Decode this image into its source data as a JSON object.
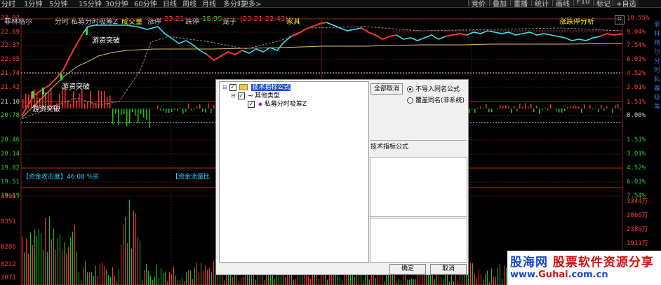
{
  "toolbar": {
    "tabs": [
      "分时",
      "1分钟",
      "5分钟",
      "15分钟",
      "30分钟",
      "60分钟",
      "日线",
      "周线",
      "月线",
      "多分时",
      "更多>"
    ],
    "right_buttons": [
      "竞价",
      "叠加",
      "重播",
      "统计",
      "画线",
      "F10",
      "标记",
      "+自选"
    ]
  },
  "title_bar": {
    "stock_name": "菲林格尔",
    "mode": "分时",
    "indicator_name": "私募分时吸筹Z",
    "volume_label": "成交量",
    "limit_up_label": "涨停",
    "limit_up_value": "23.21",
    "limit_down_label": "跌停",
    "limit_down_value": "18.99",
    "range_label": "笼子",
    "range_value": "(23.21 22.43)",
    "sector": "家具",
    "analysis_button": "涨跌停分析",
    "colors": {
      "up": "#ff4040",
      "down": "#30d030",
      "yellow": "#ffff00"
    }
  },
  "chart": {
    "left_ticks": [
      "23.03",
      "22.69",
      "22.37",
      "22.05",
      "21.74",
      "21.42",
      "21.10",
      "20.78",
      "20.46",
      "20.14",
      "19.82",
      "19.51",
      "19.19"
    ],
    "left_tick_colors": [
      "up",
      "up",
      "up",
      "up",
      "up",
      "up",
      "neutral",
      "down",
      "down",
      "down",
      "down",
      "down",
      "down"
    ],
    "right_ticks": [
      "10.55%",
      "9.04%",
      "7.54%",
      "6.03%",
      "4.52%",
      "3.01%",
      "1.51%",
      "0.00%",
      "1.51%",
      "3.01%",
      "4.52%",
      "6.03%",
      "7.54%"
    ],
    "right_tick_colors": [
      "up",
      "up",
      "up",
      "up",
      "up",
      "up",
      "up",
      "neutral",
      "down",
      "down",
      "down",
      "down",
      "down"
    ],
    "annotations": [
      "游资突破",
      "游资突破",
      "游资突破"
    ],
    "fund_strength_label": "【资金攻击度】46.08 %买",
    "fund_flow_label": "【资金流量比"
  },
  "volume": {
    "left_ticks": [
      "4496",
      "",
      "0351",
      "",
      "8286",
      "6212",
      "",
      "2071"
    ],
    "right_ticks": [
      "3344万",
      "2866万",
      "2389万",
      "1911万"
    ]
  },
  "dialog": {
    "tree": {
      "root_label": "技术指标公式",
      "child_label": "其他类型",
      "leaf_label": "私募分时吸筹Z"
    },
    "deselect_button": "全部取消",
    "radio_options": [
      {
        "label": "不导入同名公式",
        "selected": true
      },
      {
        "label": "覆盖同名(非系统)",
        "selected": false
      }
    ],
    "info_title": "技术指标公式",
    "ok_button": "确定",
    "cancel_button": "取消"
  },
  "watermark": {
    "line1_blue": "股海网",
    "line1_red": "股票软件资源分享",
    "line2_blue": "www.",
    "line2_red": "Guhai",
    "line2_blue2": ".com.cn"
  },
  "vertical_text": "菲林格尔分时私募吸筹"
}
